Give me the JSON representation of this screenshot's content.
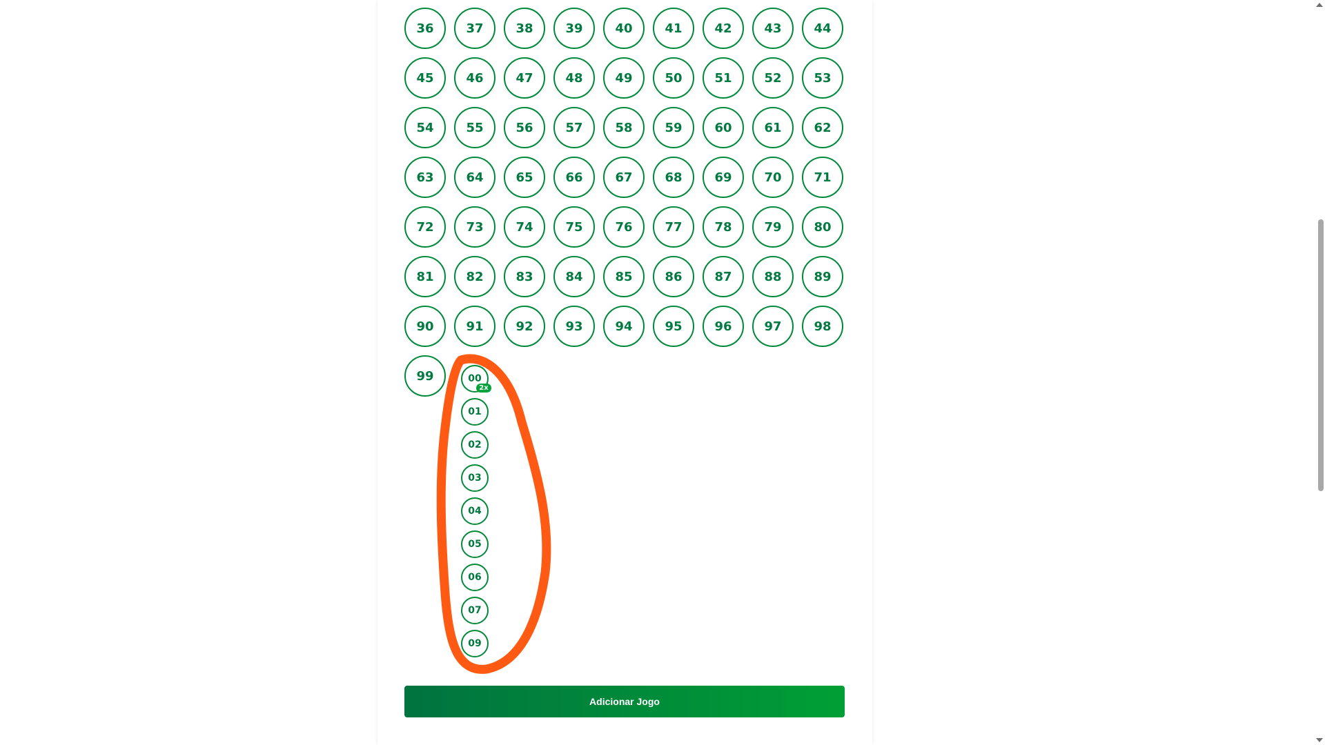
{
  "grid_numbers": [
    "36",
    "37",
    "38",
    "39",
    "40",
    "41",
    "42",
    "43",
    "44",
    "45",
    "46",
    "47",
    "48",
    "49",
    "50",
    "51",
    "52",
    "53",
    "54",
    "55",
    "56",
    "57",
    "58",
    "59",
    "60",
    "61",
    "62",
    "63",
    "64",
    "65",
    "66",
    "67",
    "68",
    "69",
    "70",
    "71",
    "72",
    "73",
    "74",
    "75",
    "76",
    "77",
    "78",
    "79",
    "80",
    "81",
    "82",
    "83",
    "84",
    "85",
    "86",
    "87",
    "88",
    "89",
    "90",
    "91",
    "92",
    "93",
    "94",
    "95",
    "96",
    "97",
    "98",
    "99"
  ],
  "small_numbers": [
    "00",
    "01",
    "02",
    "03",
    "04",
    "05",
    "06",
    "07",
    "09"
  ],
  "small_badge": {
    "on": "00",
    "label": "2x"
  },
  "add_button_label": "Adicionar Jogo",
  "colors": {
    "accent": "#00893a",
    "number_text": "#007a40",
    "annotation": "#ff5a14",
    "button_start": "#00733f",
    "button_end": "#009f35"
  }
}
